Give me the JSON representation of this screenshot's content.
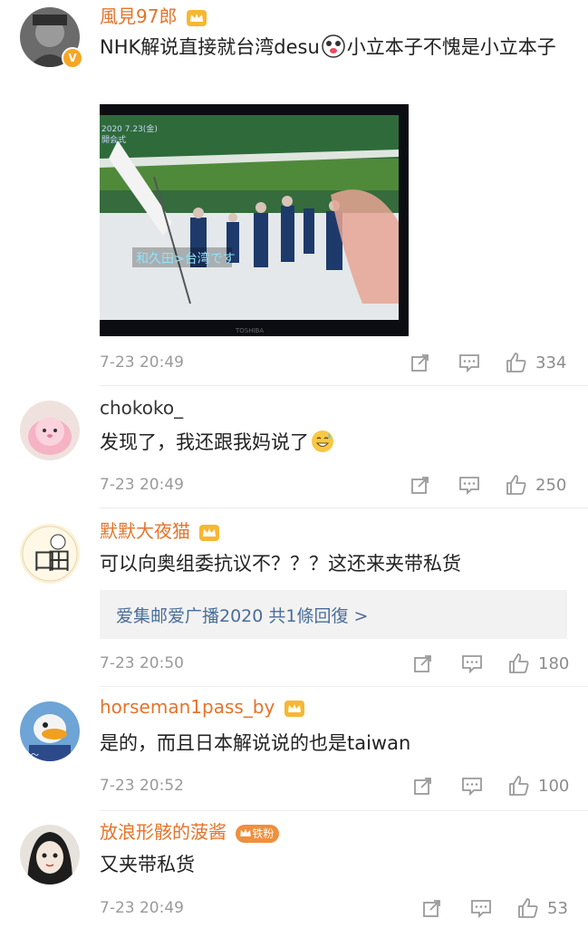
{
  "comments": [
    {
      "username": "風見97郎",
      "text": "NHK解说直接就台湾desu",
      "text_tail": "小立本子不愧是小立本子",
      "has_image": true,
      "image_caption": "和久田>台湾です",
      "image_logo": "TOSHIBA",
      "image_topleft": "2020 7.23(金)",
      "image_topleft2": "開会式",
      "time": "7-23 20:49",
      "likes": "334"
    },
    {
      "username": "chokoko_",
      "text": "发现了，我还跟我妈说了",
      "time": "7-23 20:49",
      "likes": "250"
    },
    {
      "username": "默默大夜猫",
      "text": "可以向奥组委抗议不？？？这还来夹带私货",
      "reply": "爱集邮爱广播2020 共1條回復 >",
      "time": "7-23 20:50",
      "likes": "180"
    },
    {
      "username": "horseman1pass_by",
      "text": "是的，而且日本解说说的也是taiwan",
      "time": "7-23 20:52",
      "likes": "100"
    },
    {
      "username": "放浪形骸的菠酱",
      "fan_badge": "铁粉",
      "text": "又夹带私货",
      "time": "7-23 20:49",
      "likes": "53"
    }
  ],
  "icons": [
    "share-icon",
    "comment-icon",
    "like-icon",
    "crown-icon",
    "verified-icon"
  ],
  "colors": {
    "username": "#e3742b",
    "link": "#4a6d9a",
    "meta": "#9a9a9a"
  }
}
